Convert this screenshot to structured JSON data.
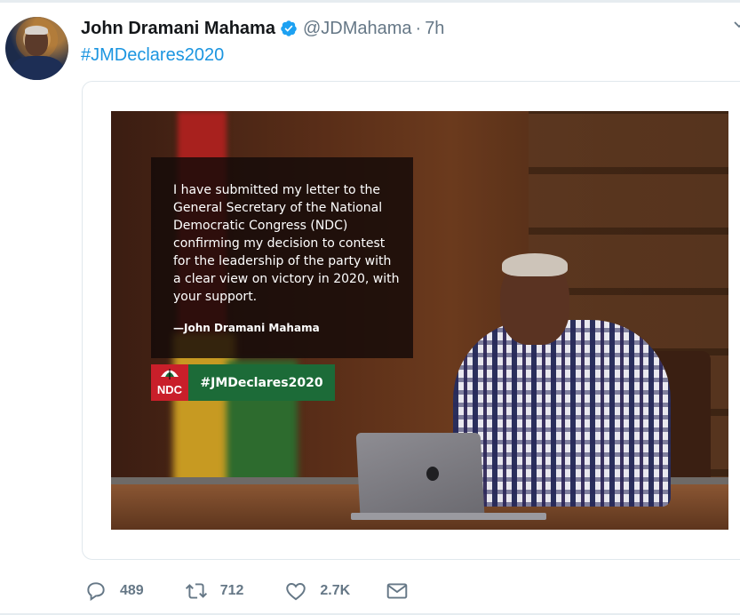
{
  "tweet": {
    "display_name": "John Dramani Mahama",
    "handle": "@JDMahama",
    "separator": "·",
    "time": "7h",
    "text": "#JMDeclares2020"
  },
  "image": {
    "quote": "I have submitted my letter to the General Secretary of the National  Democratic Congress (NDC) confirming my decision to contest for the leadership of the party with a clear view on victory in 2020, with your support.",
    "author": "—John Dramani Mahama",
    "party_logo_text": "NDC",
    "hashtag_banner": "#JMDeclares2020"
  },
  "actions": {
    "reply_count": "489",
    "retweet_count": "712",
    "like_count": "2.7K"
  },
  "colors": {
    "link_blue": "#1b95e0",
    "icon_gray": "#657786",
    "verified_blue": "#1da1f2",
    "ndc_red": "#c91f2a",
    "ndc_green": "#1c6b38"
  }
}
